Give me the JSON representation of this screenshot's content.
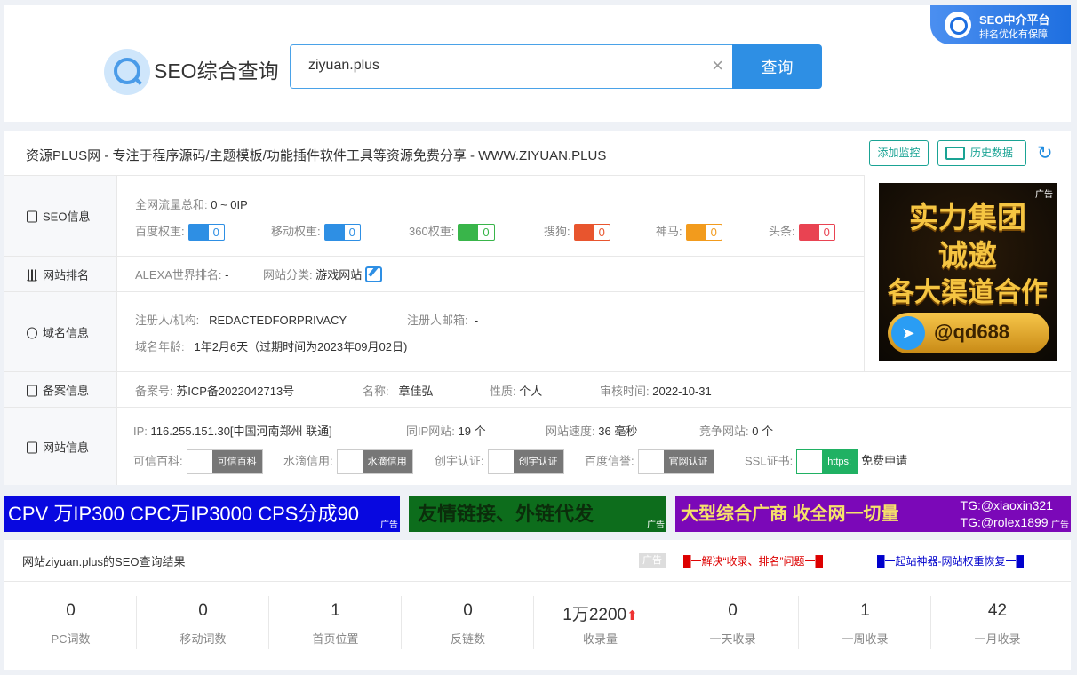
{
  "header": {
    "logo_title": "SEO综合查询",
    "search_value": "ziyuan.plus",
    "search_button": "查询",
    "clear_icon": "×",
    "corner_title": "SEO中介平台",
    "corner_subtitle": "排名优化有保障"
  },
  "site": {
    "title": "资源PLUS网 - 专注于程序源码/主题模板/功能插件软件工具等资源免费分享 - WWW.ZIYUAN.PLUS",
    "btn_monitor": "添加监控",
    "btn_history": "历史数据",
    "refresh_icon": "↻"
  },
  "seo": {
    "label": "SEO信息",
    "traffic_label": "全网流量总和:",
    "traffic_value": "0 ~ 0IP",
    "weights": [
      {
        "label": "百度权重:",
        "value": "0",
        "color": "#2e8fe4",
        "icon": "paw-icon"
      },
      {
        "label": "移动权重:",
        "value": "0",
        "color": "#2e8fe4",
        "icon": "paw-icon"
      },
      {
        "label": "360权重:",
        "value": "0",
        "color": "#39b54a",
        "icon": "360-icon"
      },
      {
        "label": "搜狗:",
        "value": "0",
        "color": "#e8552e",
        "icon": "sogou-icon"
      },
      {
        "label": "神马:",
        "value": "0",
        "color": "#f29b1d",
        "icon": "shenma-icon"
      },
      {
        "label": "头条:",
        "value": "0",
        "color": "#e94352",
        "icon": "toutiao-icon"
      }
    ]
  },
  "rank": {
    "label": "网站排名",
    "alexa_label": "ALEXA世界排名:",
    "alexa_value": "-",
    "category_label": "网站分类:",
    "category_value": "游戏网站"
  },
  "domain": {
    "label": "域名信息",
    "registrant_label": "注册人/机构:",
    "registrant_value": "REDACTEDFORPRIVACY",
    "email_label": "注册人邮箱:",
    "email_value": "-",
    "age_label": "域名年龄:",
    "age_value": "1年2月6天（过期时间为2023年09月02日)"
  },
  "icp": {
    "label": "备案信息",
    "number_label": "备案号:",
    "number_value": "苏ICP备2022042713号",
    "name_label": "名称:",
    "name_value": "章佳弘",
    "nature_label": "性质:",
    "nature_value": "个人",
    "audit_label": "审核时间:",
    "audit_value": "2022-10-31"
  },
  "web": {
    "label": "网站信息",
    "ip_label": "IP:",
    "ip_value": "116.255.151.30[中国河南郑州 联通]",
    "sameip_label": "同IP网站:",
    "sameip_value": "19 个",
    "speed_label": "网站速度:",
    "speed_value": "36 毫秒",
    "compete_label": "竞争网站:",
    "compete_value": "0 个",
    "kexin_label": "可信百科:",
    "kexin_badge": "可信百科",
    "shuidi_label": "水滴信用:",
    "shuidi_badge": "水滴信用",
    "chuangyu_label": "创宇认证:",
    "chuangyu_badge": "创宇认证",
    "baidu_label": "百度信誉:",
    "baidu_badge": "官网认证",
    "ssl_label": "SSL证书:",
    "ssl_badge": "https:",
    "ssl_apply": "免费申请"
  },
  "side_ad": {
    "tag": "广告",
    "line1": "实力集团",
    "line2": "诚邀",
    "line3": "各大渠道合作",
    "handle": "@qd688"
  },
  "banners": {
    "b1": "CPV 万IP300 CPC万IP3000 CPS分成90",
    "b2": "友情链接、外链代发",
    "b3": "大型综合广商 收全网一切量",
    "b3_tg1": "TG:@xiaoxin321",
    "b3_tg2": "TG:@rolex1899",
    "ad": "广告"
  },
  "result": {
    "title": "网站ziyuan.plus的SEO查询结果",
    "ad": "广告",
    "link1": "█一解决“收录、排名”问题一█",
    "link2": "█一起站神器-网站权重恢复一█",
    "stats": [
      {
        "value": "0",
        "label": "PC词数"
      },
      {
        "value": "0",
        "label": "移动词数"
      },
      {
        "value": "1",
        "label": "首页位置"
      },
      {
        "value": "0",
        "label": "反链数"
      },
      {
        "value": "1万2200",
        "label": "收录量"
      },
      {
        "value": "0",
        "label": "一天收录"
      },
      {
        "value": "1",
        "label": "一周收录"
      },
      {
        "value": "42",
        "label": "一月收录"
      }
    ]
  }
}
